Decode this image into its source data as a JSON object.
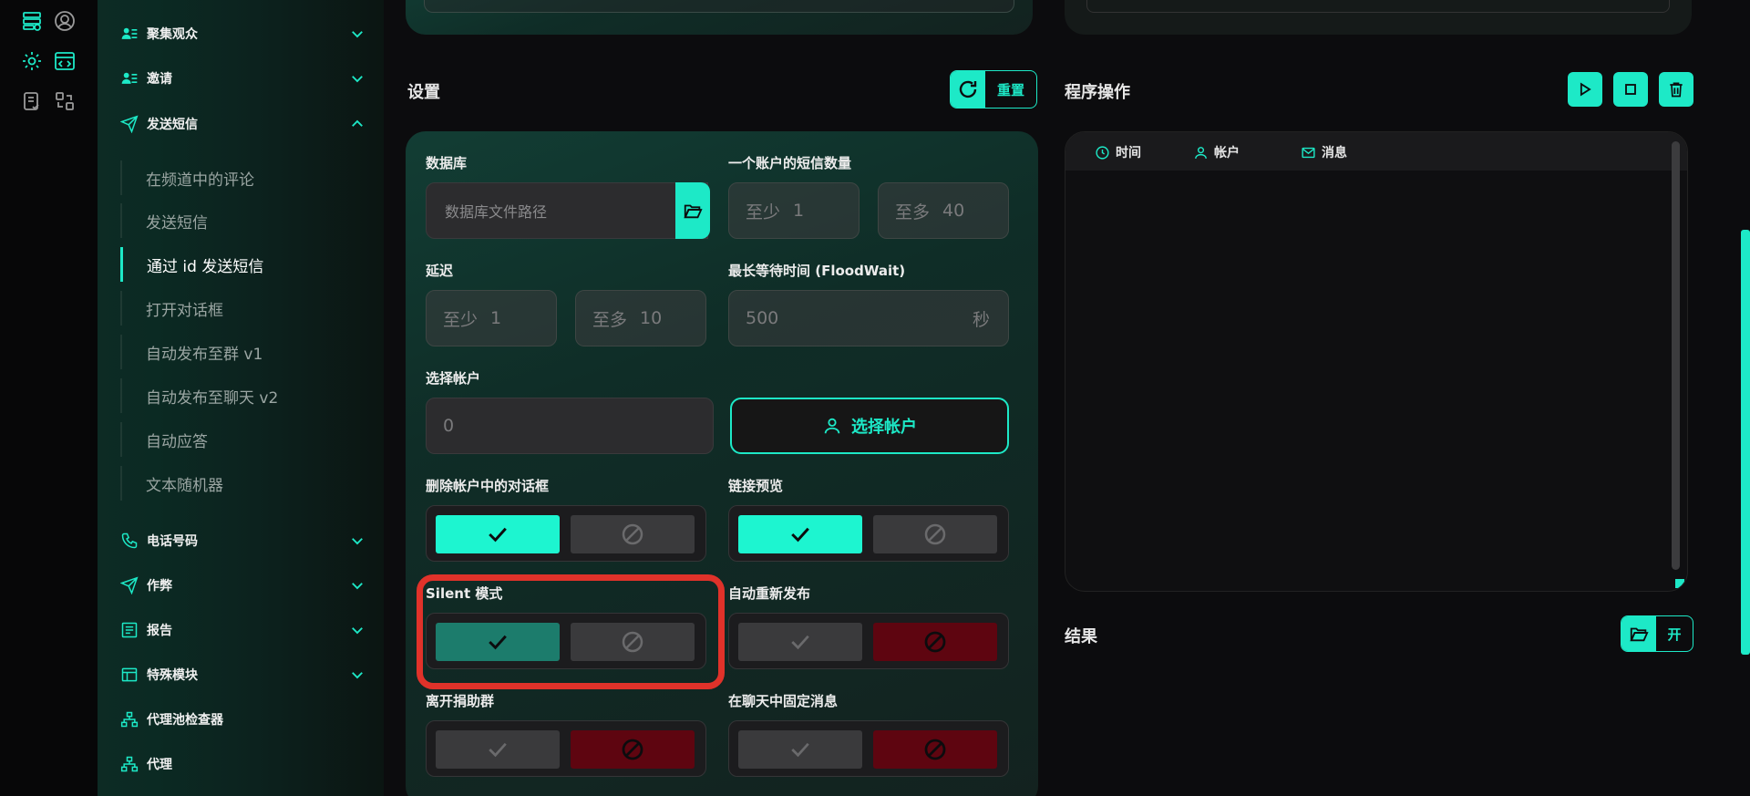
{
  "rail": {
    "icons": [
      "database-list-icon",
      "user-circle-icon",
      "gear-icon",
      "code-window-icon",
      "checklist-icon",
      "convert-icon"
    ]
  },
  "sidebar": {
    "groups": [
      {
        "label": "聚集观众",
        "icon": "users-list-icon",
        "expanded": false
      },
      {
        "label": "邀请",
        "icon": "users-list-icon",
        "expanded": false
      },
      {
        "label": "发送短信",
        "icon": "send-icon",
        "expanded": true
      },
      {
        "label": "电话号码",
        "icon": "phone-icon",
        "expanded": false
      },
      {
        "label": "作弊",
        "icon": "send-icon",
        "expanded": false
      },
      {
        "label": "报告",
        "icon": "report-icon",
        "expanded": false
      },
      {
        "label": "特殊模块",
        "icon": "table-icon",
        "expanded": false
      },
      {
        "label": "代理池检查器",
        "icon": "network-icon"
      },
      {
        "label": "代理",
        "icon": "network-icon"
      }
    ],
    "sub_items": [
      {
        "label": "在频道中的评论",
        "active": false
      },
      {
        "label": "发送短信",
        "active": false
      },
      {
        "label": "通过 id 发送短信",
        "active": true
      },
      {
        "label": "打开对话框",
        "active": false
      },
      {
        "label": "自动发布至群 v1",
        "active": false
      },
      {
        "label": "自动发布至聊天 v2",
        "active": false
      },
      {
        "label": "自动应答",
        "active": false
      },
      {
        "label": "文本随机器",
        "active": false
      }
    ]
  },
  "settings": {
    "title": "设置",
    "reset_label": "重置",
    "database_label": "数据库",
    "database_placeholder": "数据库文件路径",
    "sms_per_account_label": "一个账户的短信数量",
    "sms_min_prefix": "至少",
    "sms_min_value": "1",
    "sms_max_prefix": "至多",
    "sms_max_value": "40",
    "delay_label": "延迟",
    "delay_min_prefix": "至少",
    "delay_min_value": "1",
    "delay_max_prefix": "至多",
    "delay_max_value": "10",
    "floodwait_label": "最长等待时间 (FloodWait)",
    "floodwait_value": "500",
    "floodwait_unit": "秒",
    "select_accounts_label": "选择帐户",
    "select_accounts_value": "0",
    "select_accounts_button": "选择帐户",
    "toggles": [
      {
        "label": "删除帐户中的对话框",
        "state": "on"
      },
      {
        "label": "链接预览",
        "state": "on"
      },
      {
        "label": "Silent 模式",
        "state": "on"
      },
      {
        "label": "自动重新发布",
        "state": "off"
      },
      {
        "label": "离开捐助群",
        "state": "off"
      },
      {
        "label": "在聊天中固定消息",
        "state": "off"
      }
    ]
  },
  "program": {
    "title": "程序操作",
    "columns": [
      "时间",
      "帐户",
      "消息"
    ]
  },
  "result": {
    "title": "结果",
    "open_label": "开"
  },
  "colors": {
    "accent": "#1de9c7",
    "danger": "#5e0510",
    "highlight": "#e0322a"
  }
}
